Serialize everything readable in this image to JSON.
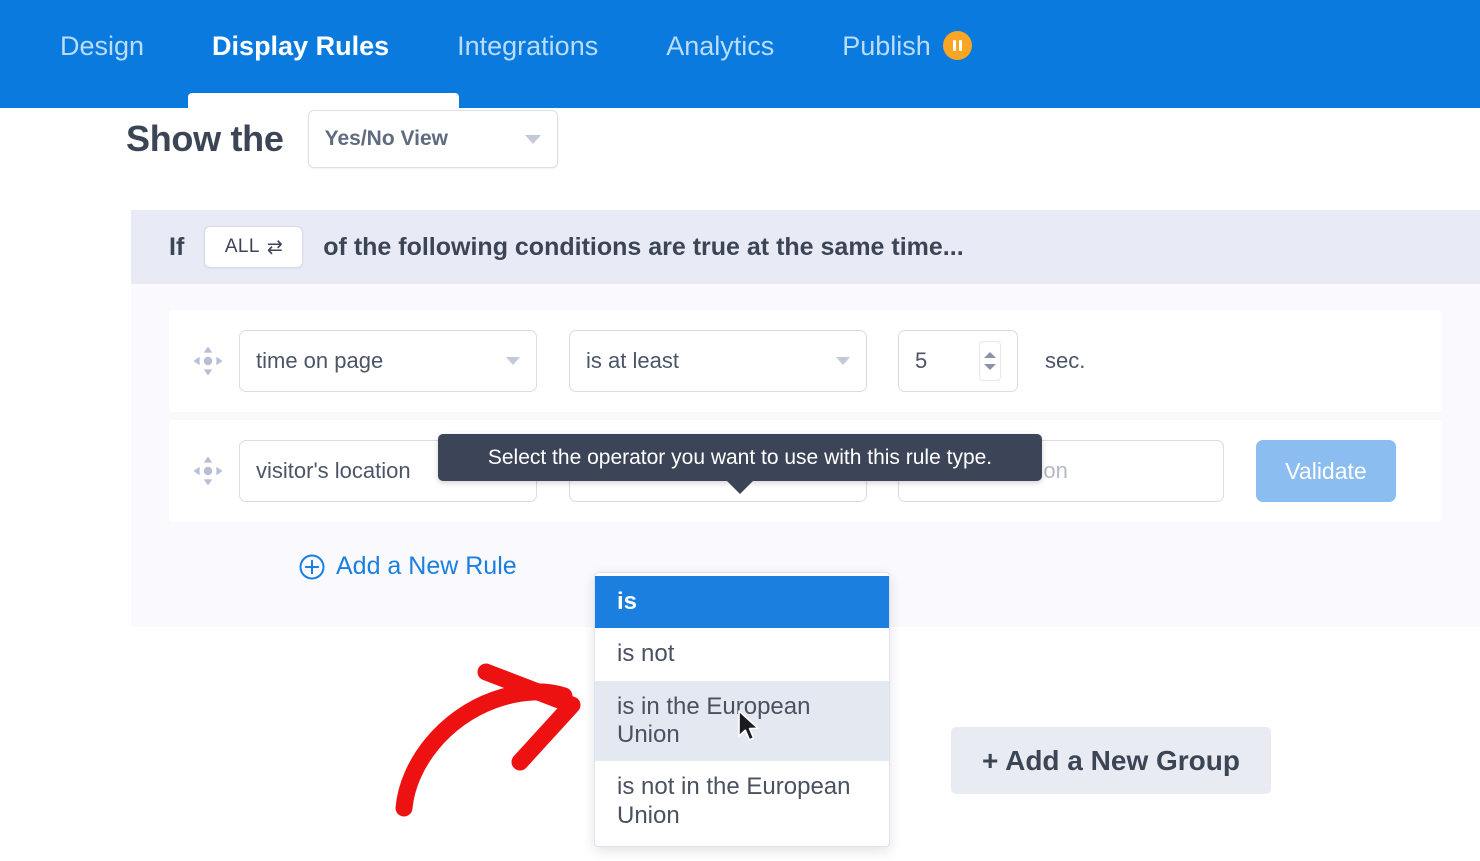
{
  "nav": {
    "items": [
      {
        "label": "Design",
        "active": false
      },
      {
        "label": "Display Rules",
        "active": true
      },
      {
        "label": "Integrations",
        "active": false
      },
      {
        "label": "Analytics",
        "active": false
      },
      {
        "label": "Publish",
        "active": false,
        "badge": "pause-icon"
      }
    ],
    "background_color": "#0b7ade",
    "active_text_color": "#ffffff",
    "inactive_text_color": "#b9ddfa",
    "badge_color": "#f9a625"
  },
  "show_row": {
    "label": "Show the",
    "view_select": {
      "value": "Yes/No View",
      "icon": "chevron-down-icon"
    }
  },
  "conditions_bar": {
    "if_label": "If",
    "all_button": {
      "label": "ALL",
      "icon": "swap-icon"
    },
    "text": "of the following conditions are true at the same time...",
    "background_color": "#e8ebf5"
  },
  "rules": [
    {
      "drag_icon": "move-icon",
      "type": {
        "value": "time on page",
        "icon": "chevron-down-icon"
      },
      "operator": {
        "value": "is at least",
        "icon": "chevron-down-icon"
      },
      "value": {
        "value": "5",
        "icon": "stepper-icon"
      },
      "unit": "sec."
    },
    {
      "drag_icon": "move-icon",
      "type": {
        "value": "visitor's location",
        "icon": "chevron-down-icon"
      },
      "operator": {
        "value": "is",
        "icon": "chevron-down-icon"
      },
      "location": {
        "value": "",
        "placeholder": "Enter a location"
      },
      "validate_button": {
        "label": "Validate",
        "color": "#8cbdf0"
      }
    }
  ],
  "add_rule": {
    "label": "Add a New Rule",
    "icon": "plus-circle-icon",
    "color": "#1b7fe0"
  },
  "tooltip": {
    "text": "Select the operator you want to use with this rule type.",
    "background_color": "#3c4458"
  },
  "operator_dropdown": {
    "options": [
      {
        "label": "is",
        "state": "selected"
      },
      {
        "label": "is not",
        "state": "normal"
      },
      {
        "label": "is in the European Union",
        "state": "hover"
      },
      {
        "label": "is not in the European Union",
        "state": "normal"
      }
    ],
    "selected_color": "#1b7fe0",
    "hover_color": "#e4e8f0"
  },
  "add_group": {
    "label": "+ Add a New Group"
  },
  "annotation": {
    "type": "curved-arrow",
    "color": "#ee1111",
    "direction": "right"
  },
  "cursor": {
    "type": "arrow-pointer"
  }
}
